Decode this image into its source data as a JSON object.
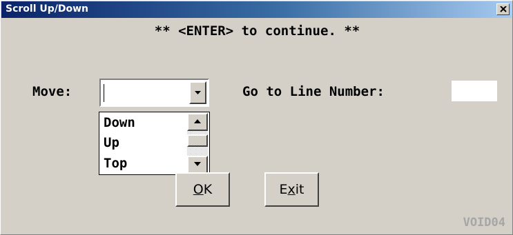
{
  "window": {
    "title": "Scroll Up/Down",
    "close_glyph": "×"
  },
  "instruction": "** <ENTER> to continue. **",
  "move": {
    "label": "Move:",
    "value": "",
    "options": [
      "Down",
      "Up",
      "Top"
    ]
  },
  "goto": {
    "label": "Go to Line Number:",
    "value": ""
  },
  "buttons": {
    "ok": {
      "mnemonic": "O",
      "rest": "K"
    },
    "exit": {
      "before": "E",
      "mnemonic": "x",
      "after": "it"
    }
  },
  "form_id": "VOID04",
  "colors": {
    "dialog_bg": "#d4d0c8",
    "title_start": "#0a246a",
    "title_end": "#a6caf0",
    "form_id": "#a6a6a6"
  },
  "icons": {
    "close": "close-icon",
    "dropdown": "chevron-down-icon",
    "scroll_up": "scroll-up-arrow-icon",
    "scroll_down": "scroll-down-arrow-icon"
  }
}
